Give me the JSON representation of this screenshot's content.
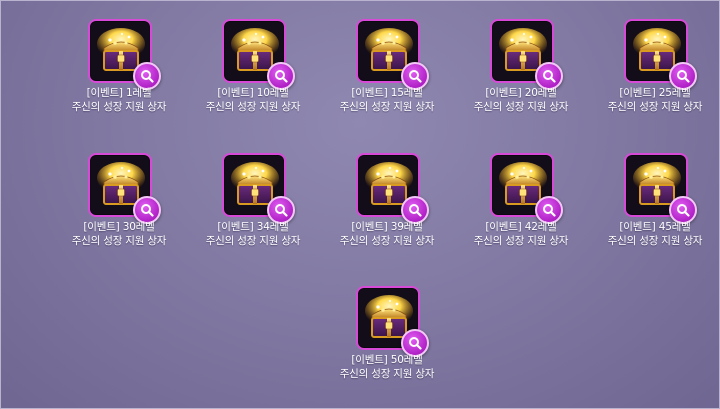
{
  "rewards": [
    {
      "tag": "[이벤트]",
      "level": "1레벨",
      "name": "주신의 성장 지원 상자"
    },
    {
      "tag": "[이벤트]",
      "level": "10레벨",
      "name": "주신의 성장 지원 상자"
    },
    {
      "tag": "[이벤트]",
      "level": "15레벨",
      "name": "주신의 성장 지원 상자"
    },
    {
      "tag": "[이벤트]",
      "level": "20레벨",
      "name": "주신의 성장 지원 상자"
    },
    {
      "tag": "[이벤트]",
      "level": "25레벨",
      "name": "주신의 성장 지원 상자"
    },
    {
      "tag": "[이벤트]",
      "level": "30레벨",
      "name": "주신의 성장 지원 상자"
    },
    {
      "tag": "[이벤트]",
      "level": "34레벨",
      "name": "주신의 성장 지원 상자"
    },
    {
      "tag": "[이벤트]",
      "level": "39레벨",
      "name": "주신의 성장 지원 상자"
    },
    {
      "tag": "[이벤트]",
      "level": "42레벨",
      "name": "주신의 성장 지원 상자"
    },
    {
      "tag": "[이벤트]",
      "level": "45레벨",
      "name": "주신의 성장 지원 상자"
    },
    {
      "tag": "[이벤트]",
      "level": "50레벨",
      "name": "주신의 성장 지원 상자"
    }
  ],
  "icons": {
    "item": "treasure-chest-icon",
    "action": "magnifier-icon"
  },
  "colors": {
    "background": "#827aa3",
    "slot_border": "#d74ad8",
    "zoom_button": "#b021c6",
    "label_text": "#ffffff"
  }
}
